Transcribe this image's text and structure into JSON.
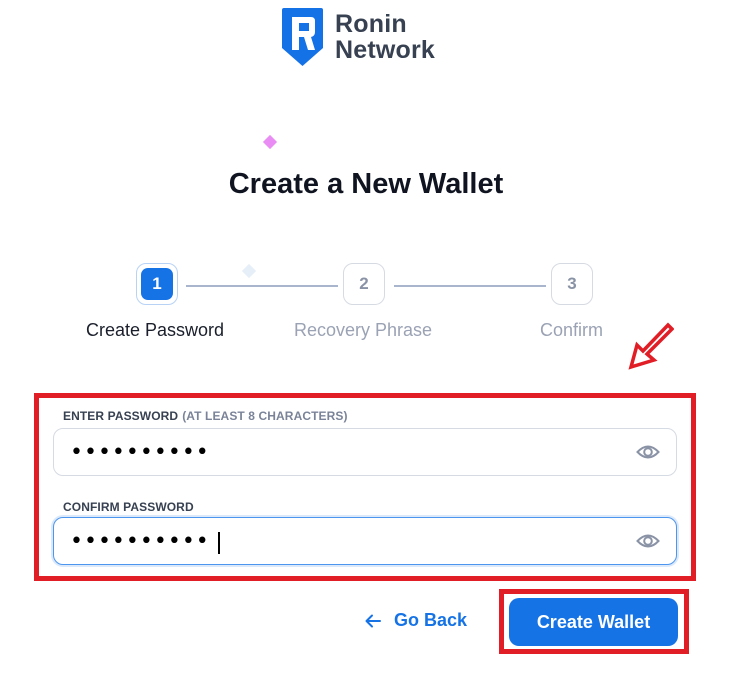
{
  "logo": {
    "line1": "Ronin",
    "line2": "Network",
    "icon": "ronin-shield-icon"
  },
  "page_title": "Create a New Wallet",
  "steps": [
    {
      "number": "1",
      "label": "Create Password",
      "state": "active"
    },
    {
      "number": "2",
      "label": "Recovery Phrase",
      "state": "inactive"
    },
    {
      "number": "3",
      "label": "Confirm",
      "state": "inactive"
    }
  ],
  "form": {
    "password": {
      "label": "ENTER PASSWORD",
      "hint": "(AT LEAST 8 CHARACTERS)",
      "value": "••••••••••",
      "toggle_icon": "eye-icon"
    },
    "confirm": {
      "label": "CONFIRM PASSWORD",
      "value": "••••••••••",
      "toggle_icon": "eye-icon"
    }
  },
  "actions": {
    "back_label": "Go Back",
    "back_icon": "arrow-left-icon",
    "create_label": "Create Wallet"
  },
  "colors": {
    "accent": "#1573e6",
    "annotation_red": "#e11d25",
    "sparkle_pink": "#e98cf3"
  }
}
